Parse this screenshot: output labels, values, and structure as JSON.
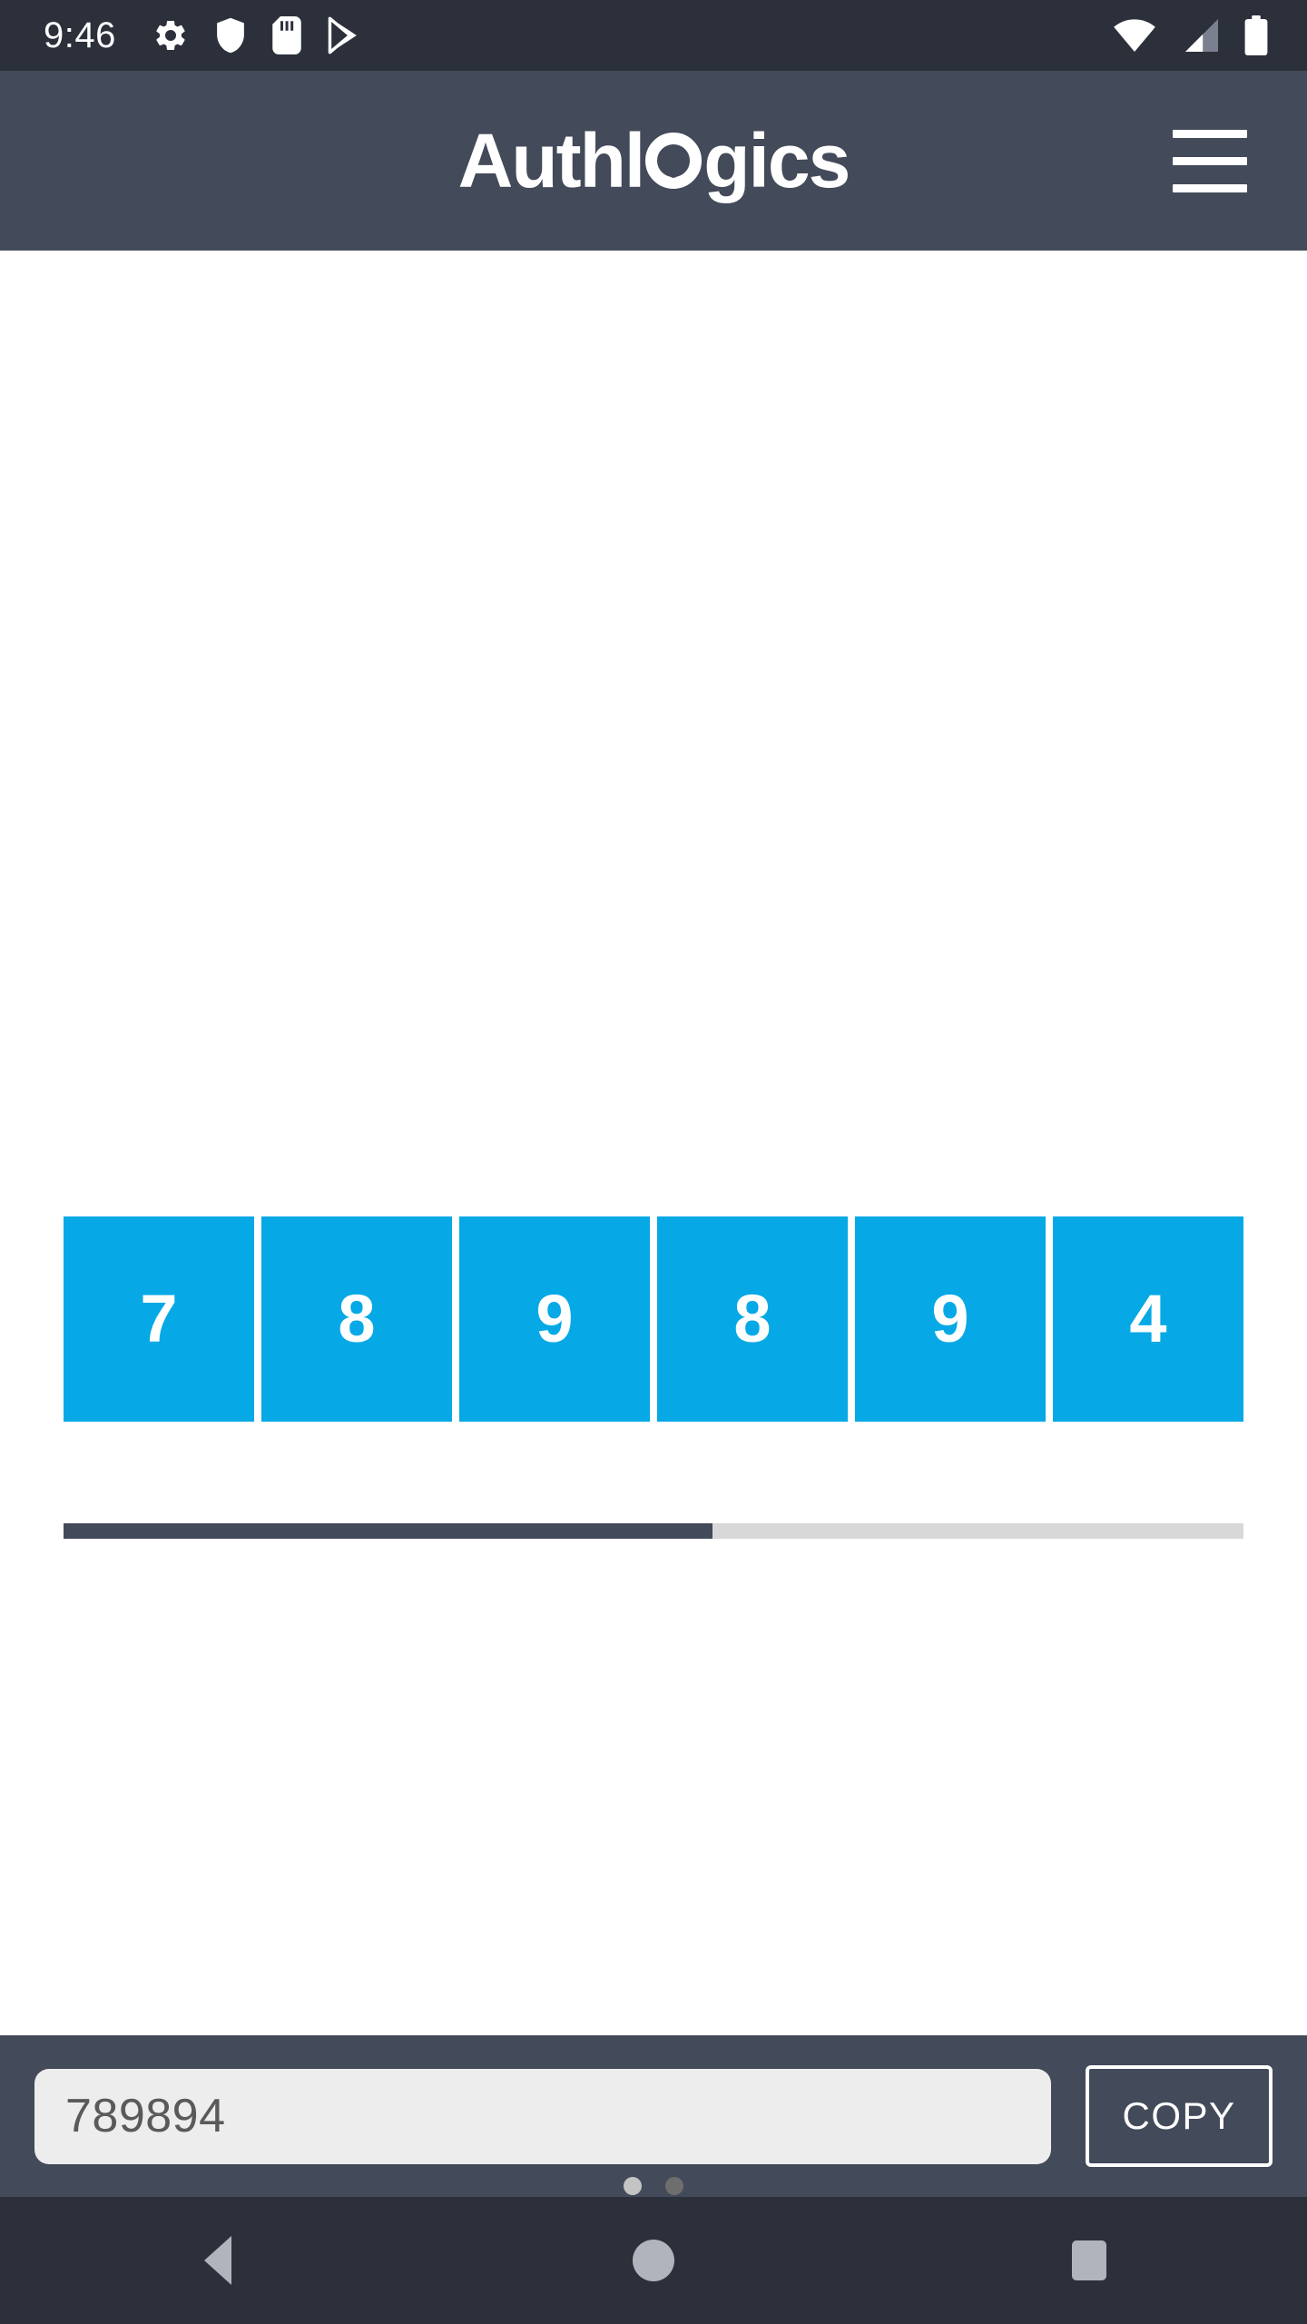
{
  "status_bar": {
    "time": "9:46",
    "left_icons": [
      "gear-icon",
      "shield-icon",
      "sd-card-icon",
      "play-store-icon"
    ],
    "right_icons": [
      "wifi-icon",
      "cellular-signal-icon",
      "battery-icon"
    ],
    "background_color": "#2C303B"
  },
  "header": {
    "brand_prefix": "Authl",
    "brand_keyhole_letter": "o",
    "brand_suffix": "gics",
    "brand_full": "Authlogics",
    "menu_icon": "hamburger-menu-icon",
    "background_color": "#434A59"
  },
  "otp": {
    "digits": [
      "7",
      "8",
      "9",
      "8",
      "9",
      "4"
    ],
    "tile_color": "#06A9E5",
    "digit_color": "#FFFFFF",
    "progress": {
      "percent": 55,
      "fill_color": "#434A59",
      "track_color": "#D8D8D8"
    }
  },
  "pager": {
    "dots": [
      {
        "active": false
      },
      {
        "active": true
      }
    ],
    "active_color": "#6E6E6E",
    "inactive_color": "#C4C4C4"
  },
  "action_bar": {
    "code_value": "789894",
    "code_placeholder": "789894",
    "copy_label": "COPY",
    "background_color": "#434A59"
  },
  "nav_bar": {
    "back_icon": "back-triangle-icon",
    "home_icon": "home-circle-icon",
    "recents_icon": "recents-square-icon",
    "background_color": "#2C303B"
  }
}
